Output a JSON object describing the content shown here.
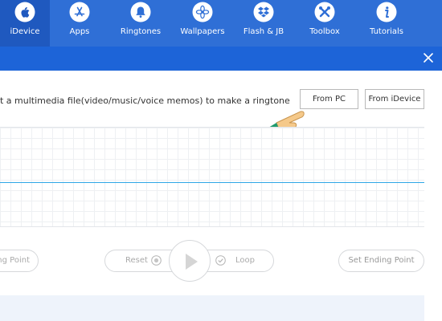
{
  "nav": {
    "items": [
      {
        "label": "iDevice",
        "icon": "apple-icon",
        "active": true
      },
      {
        "label": "Apps",
        "icon": "app-store-icon"
      },
      {
        "label": "Ringtones",
        "icon": "bell-icon"
      },
      {
        "label": "Wallpapers",
        "icon": "flower-icon"
      },
      {
        "label": "Flash & JB",
        "icon": "dropbox-icon"
      },
      {
        "label": "Toolbox",
        "icon": "tools-icon"
      },
      {
        "label": "Tutorials",
        "icon": "info-icon"
      }
    ]
  },
  "colors": {
    "nav_bg": "#2f6fd6",
    "nav_active": "#1f59bf",
    "titlebar": "#1d64d8",
    "wave_line": "#2da6e6"
  },
  "instruction": "t a multimedia file(video/music/voice memos) to make a ringtone",
  "buttons": {
    "from_pc": "From PC",
    "from_idevice": "From iDevice"
  },
  "controls": {
    "start_label": "ng Point",
    "reset_label": "Reset",
    "loop_label": "Loop",
    "end_label": "Set Ending Point"
  }
}
